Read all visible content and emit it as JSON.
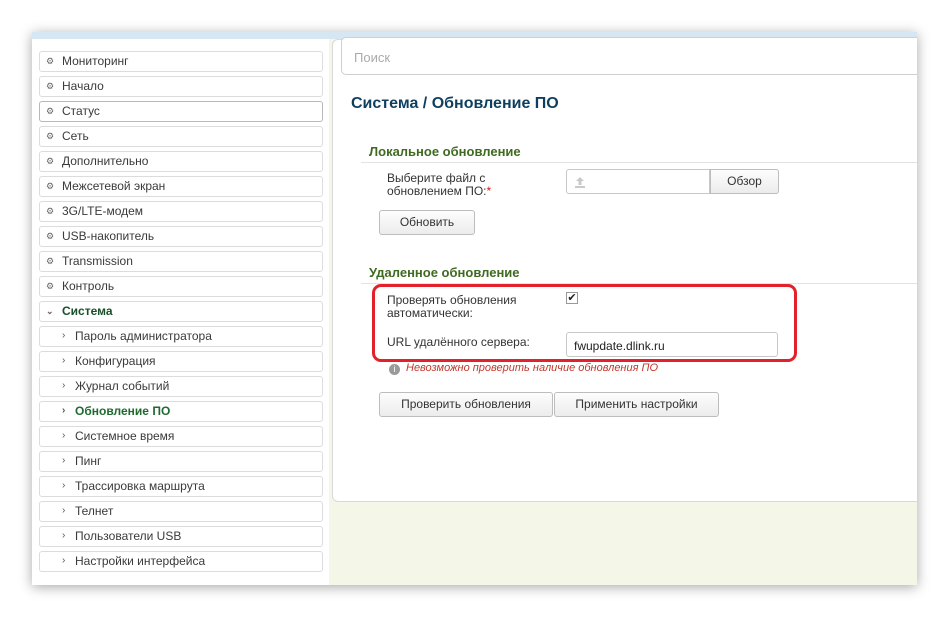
{
  "search": {
    "placeholder": "Поиск"
  },
  "breadcrumb": {
    "section": "Система",
    "separator": "/",
    "page": "Обновление ПО"
  },
  "sidebar": {
    "items": [
      {
        "label": "Мониторинг",
        "icon": "gear-icon"
      },
      {
        "label": "Начало",
        "icon": "gear-icon"
      },
      {
        "label": "Статус",
        "icon": "gear-icon"
      },
      {
        "label": "Сеть",
        "icon": "gear-icon"
      },
      {
        "label": "Дополнительно",
        "icon": "gear-icon"
      },
      {
        "label": "Межсетевой экран",
        "icon": "gear-icon"
      },
      {
        "label": "3G/LTE-модем",
        "icon": "gear-icon"
      },
      {
        "label": "USB-накопитель",
        "icon": "gear-icon"
      },
      {
        "label": "Transmission",
        "icon": "gear-icon"
      },
      {
        "label": "Контроль",
        "icon": "gear-icon"
      },
      {
        "label": "Система",
        "icon": "chevron-down-icon"
      }
    ],
    "subitems": [
      {
        "label": "Пароль администратора"
      },
      {
        "label": "Конфигурация"
      },
      {
        "label": "Журнал событий"
      },
      {
        "label": "Обновление ПО"
      },
      {
        "label": "Системное время"
      },
      {
        "label": "Пинг"
      },
      {
        "label": "Трассировка маршрута"
      },
      {
        "label": "Телнет"
      },
      {
        "label": "Пользователи USB"
      },
      {
        "label": "Настройки интерфейса"
      }
    ]
  },
  "local_update": {
    "title": "Локальное обновление",
    "file_label_line1": "Выберите файл с",
    "file_label_line2": "обновлением ПО:",
    "required_mark": "*",
    "browse_label": "Обзор",
    "update_label": "Обновить"
  },
  "remote_update": {
    "title": "Удаленное обновление",
    "auto_check_line1": "Проверять обновления",
    "auto_check_line2": "автоматически:",
    "auto_check_checked": true,
    "url_label": "URL удалённого сервера:",
    "url_value": "fwupdate.dlink.ru",
    "warning_text": "Невозможно проверить наличие обновления ПО",
    "check_label": "Проверить обновления",
    "apply_label": "Применить настройки"
  },
  "colors": {
    "accent": "#0f3f5f",
    "section": "#3f6a20",
    "highlight": "#e3212a",
    "active": "#1f6a2f"
  }
}
